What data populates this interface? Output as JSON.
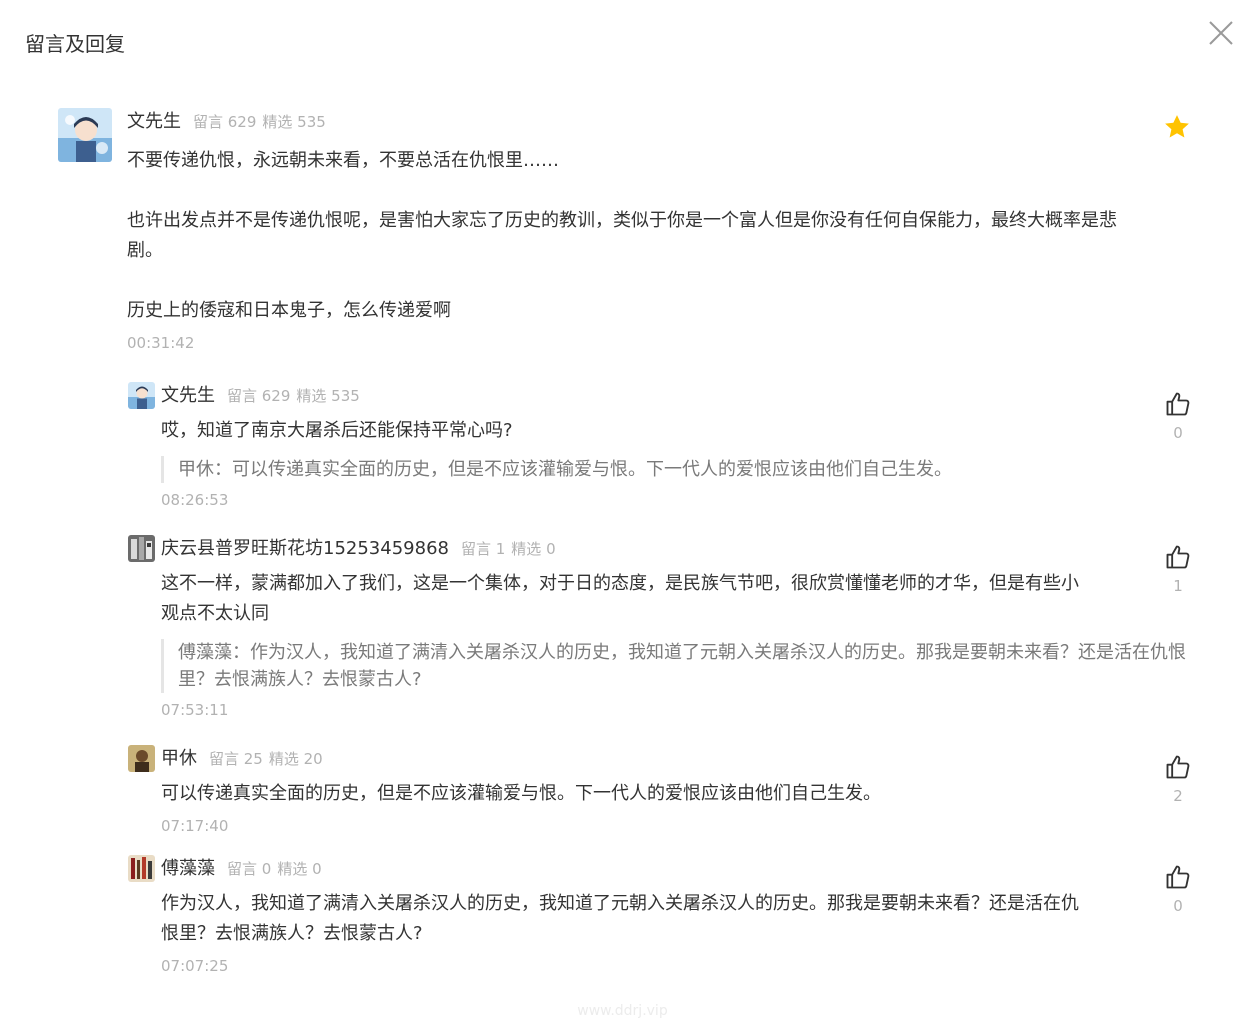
{
  "panel": {
    "title": "留言及回复"
  },
  "main_comment": {
    "user_name": "文先生",
    "stats_comments_label": "留言 629",
    "stats_featured_label": "精选 535",
    "paragraphs": [
      "不要传递仇恨，永远朝未来看，不要总活在仇恨里……",
      "也许出发点并不是传递仇恨呢，是害怕大家忘了历史的教训，类似于你是一个富人但是你没有任何自保能力，最终大概率是悲剧。",
      "历史上的倭寇和日本鬼子，怎么传递爱啊"
    ],
    "time": "00:31:42",
    "starred": true
  },
  "replies": [
    {
      "user_name": "文先生",
      "stats_comments_label": "留言 629",
      "stats_featured_label": "精选 535",
      "content": "哎，知道了南京大屠杀后还能保持平常心吗?",
      "quote": "甲休：可以传递真实全面的历史，但是不应该灌输爱与恨。下一代人的爱恨应该由他们自己生发。",
      "time": "08:26:53",
      "likes": "0"
    },
    {
      "user_name": "庆云县普罗旺斯花坊15253459868",
      "stats_comments_label": "留言 1",
      "stats_featured_label": "精选 0",
      "content": "这不一样，蒙满都加入了我们，这是一个集体，对于日的态度，是民族气节吧，很欣赏懂懂老师的才华，但是有些小观点不太认同",
      "quote": "傅藻藻：作为汉人，我知道了满清入关屠杀汉人的历史，我知道了元朝入关屠杀汉人的历史。那我是要朝未来看？还是活在仇恨里？去恨满族人？去恨蒙古人?",
      "time": "07:53:11",
      "likes": "1"
    },
    {
      "user_name": "甲休",
      "stats_comments_label": "留言 25",
      "stats_featured_label": "精选 20",
      "content": "可以传递真实全面的历史，但是不应该灌输爱与恨。下一代人的爱恨应该由他们自己生发。",
      "quote": "",
      "time": "07:17:40",
      "likes": "2"
    },
    {
      "user_name": "傅藻藻",
      "stats_comments_label": "留言 0",
      "stats_featured_label": "精选 0",
      "content": "作为汉人，我知道了满清入关屠杀汉人的历史，我知道了元朝入关屠杀汉人的历史。那我是要朝未来看？还是活在仇恨里？去恨满族人？去恨蒙古人?",
      "quote": "",
      "time": "07:07:25",
      "likes": "0"
    }
  ],
  "watermark": "www.ddrj.vip",
  "colors": {
    "star": "#ffc300",
    "muted_text": "#b2b2b2",
    "quote_text": "#7a7a7a",
    "quote_border": "#e5e5e5"
  },
  "icons": {
    "close": "close-icon",
    "star": "star-icon",
    "like": "thumbs-up-icon"
  }
}
